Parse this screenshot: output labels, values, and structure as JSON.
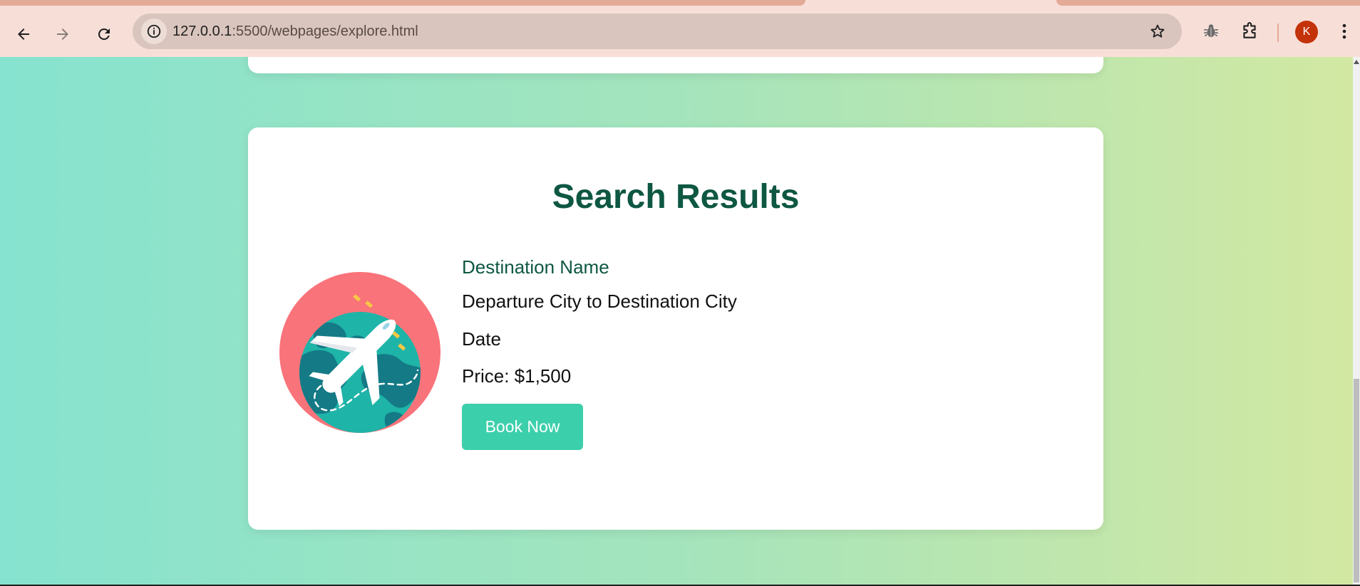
{
  "browser": {
    "url_host": "127.0.0.1",
    "url_path": ":5500/webpages/explore.html",
    "profile_initial": "K",
    "icons": [
      "back-arrow-icon",
      "forward-arrow-icon",
      "reload-icon",
      "site-info-icon",
      "star-icon",
      "bug-extension-icon",
      "puzzle-extension-icon",
      "kebab-menu-icon"
    ]
  },
  "results": {
    "heading": "Search Results",
    "items": [
      {
        "destination_name": "Destination Name",
        "route": "Departure City to Destination City",
        "date": "Date",
        "price": "Price: $1,500",
        "book_label": "Book Now",
        "image_icon": "globe-airplane-icon"
      }
    ]
  },
  "colors": {
    "heading": "#0e5742",
    "button": "#3ccfab",
    "gradient_start": "#86e3cf",
    "gradient_end": "#d2e8a2",
    "chrome": "#f7dfd8"
  }
}
